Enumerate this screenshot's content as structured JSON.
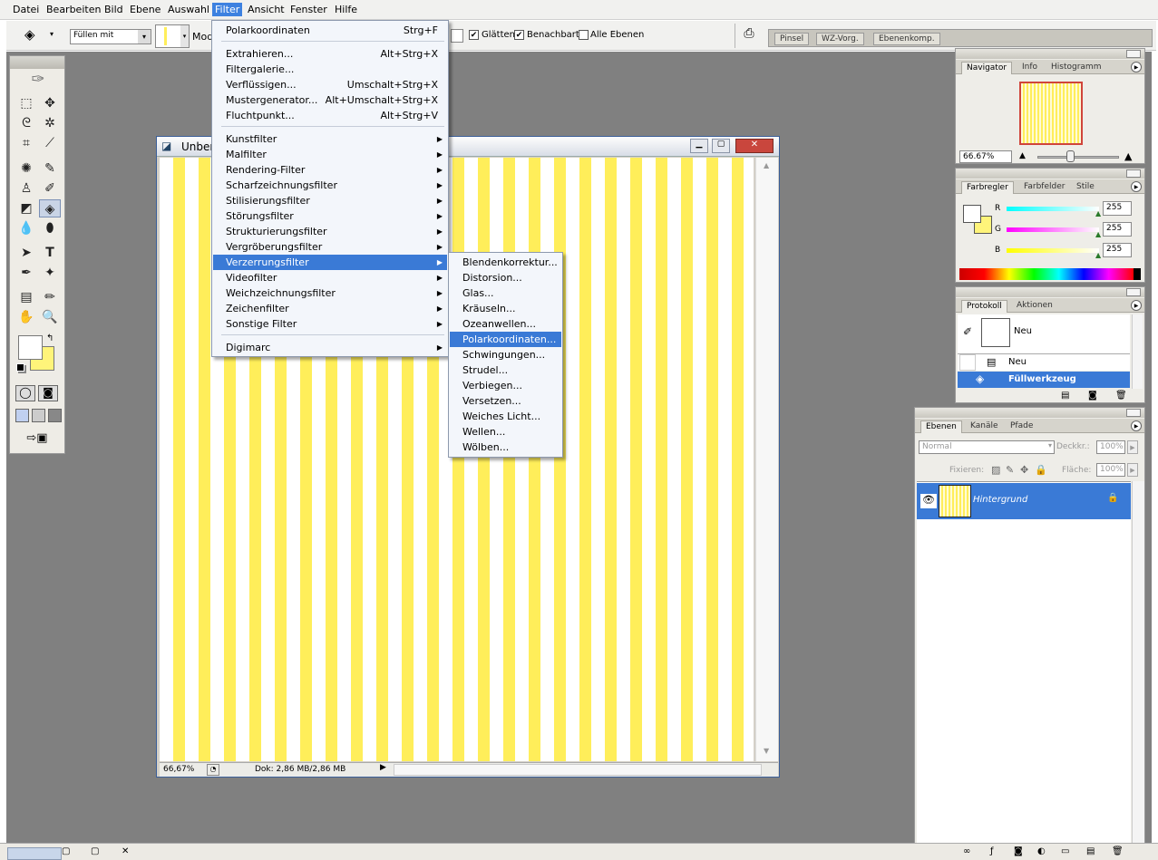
{
  "menubar": {
    "items": [
      "Datei",
      "Bearbeiten",
      "Bild",
      "Ebene",
      "Auswahl",
      "Filter",
      "Ansicht",
      "Fenster",
      "Hilfe"
    ],
    "active": "Filter"
  },
  "optionsbar": {
    "fill_source": "Füllen mit",
    "mode_label": "Mod",
    "smooth": "Glätten",
    "contiguous": "Benachbart",
    "all_layers": "Alle Ebenen",
    "well_tabs": [
      "Pinsel",
      "WZ-Vorg.",
      "Ebenenkomp."
    ]
  },
  "document": {
    "title": "Unber",
    "zoom": "66,67%",
    "doc_info": "Dok: 2,86 MB/2,86 MB",
    "stripe_color": "#ffee5a"
  },
  "filter_menu": {
    "last_filter": {
      "label": "Polarkoordinaten",
      "shortcut": "Strg+F"
    },
    "group1": [
      {
        "label": "Extrahieren...",
        "shortcut": "Alt+Strg+X"
      },
      {
        "label": "Filtergalerie...",
        "shortcut": ""
      },
      {
        "label": "Verflüssigen...",
        "shortcut": "Umschalt+Strg+X"
      },
      {
        "label": "Mustergenerator...",
        "shortcut": "Alt+Umschalt+Strg+X"
      },
      {
        "label": "Fluchtpunkt...",
        "shortcut": "Alt+Strg+V"
      }
    ],
    "group2": [
      "Kunstfilter",
      "Malfilter",
      "Rendering-Filter",
      "Scharfzeichnungsfilter",
      "Stilisierungsfilter",
      "Störungsfilter",
      "Strukturierungsfilter",
      "Vergröberungsfilter",
      "Verzerrungsfilter",
      "Videofilter",
      "Weichzeichnungsfilter",
      "Zeichenfilter",
      "Sonstige Filter"
    ],
    "highlighted": "Verzerrungsfilter",
    "group3": [
      "Digimarc"
    ]
  },
  "submenu": {
    "items": [
      "Blendenkorrektur...",
      "Distorsion...",
      "Glas...",
      "Kräuseln...",
      "Ozeanwellen...",
      "Polarkoordinaten...",
      "Schwingungen...",
      "Strudel...",
      "Verbiegen...",
      "Versetzen...",
      "Weiches Licht...",
      "Wellen...",
      "Wölben..."
    ],
    "highlighted": "Polarkoordinaten..."
  },
  "navigator": {
    "tabs": [
      "Navigator",
      "Info",
      "Histogramm"
    ],
    "zoom": "66.67%"
  },
  "color": {
    "tabs": [
      "Farbregler",
      "Farbfelder",
      "Stile"
    ],
    "channels": [
      {
        "name": "R",
        "value": "255"
      },
      {
        "name": "G",
        "value": "255"
      },
      {
        "name": "B",
        "value": "255"
      }
    ],
    "bg_color": "#fff47a"
  },
  "history": {
    "tabs": [
      "Protokoll",
      "Aktionen"
    ],
    "snapshot": "Neu",
    "steps": [
      "Neu",
      "Füllwerkzeug"
    ],
    "active": "Füllwerkzeug"
  },
  "layers": {
    "tabs": [
      "Ebenen",
      "Kanäle",
      "Pfade"
    ],
    "blend_mode": "Normal",
    "opacity_label": "Deckkr.:",
    "opacity": "100%",
    "lock_label": "Fixieren:",
    "fill_label": "Fläche:",
    "fill": "100%",
    "layer_name": "Hintergrund"
  },
  "colors": {
    "accent": "#3a7ad6",
    "workspace": "#808080"
  }
}
